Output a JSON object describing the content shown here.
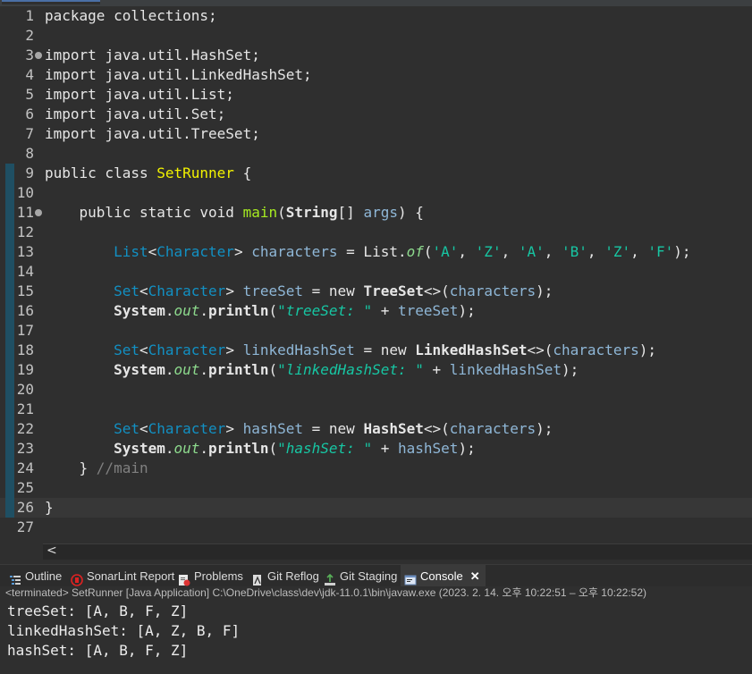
{
  "editor": {
    "lines": [
      {
        "n": "1",
        "tokens": [
          [
            "kw",
            "package "
          ],
          [
            "type",
            "collections"
          ],
          [
            "kw",
            ";"
          ]
        ]
      },
      {
        "n": "2",
        "tokens": []
      },
      {
        "n": "3",
        "fold": true,
        "tokens": [
          [
            "kw",
            "import "
          ],
          [
            "type",
            "java.util.HashSet;"
          ]
        ]
      },
      {
        "n": "4",
        "tokens": [
          [
            "kw",
            "import "
          ],
          [
            "type",
            "java.util.LinkedHashSet;"
          ]
        ]
      },
      {
        "n": "5",
        "tokens": [
          [
            "kw",
            "import "
          ],
          [
            "type",
            "java.util.List;"
          ]
        ]
      },
      {
        "n": "6",
        "tokens": [
          [
            "kw",
            "import "
          ],
          [
            "type",
            "java.util.Set;"
          ]
        ]
      },
      {
        "n": "7",
        "tokens": [
          [
            "kw",
            "import "
          ],
          [
            "type",
            "java.util.TreeSet;"
          ]
        ]
      },
      {
        "n": "8",
        "tokens": []
      },
      {
        "n": "9",
        "rail": true,
        "tokens": [
          [
            "kw",
            "public class "
          ],
          [
            "loc",
            "SetRunner"
          ],
          [
            "kw",
            " {"
          ]
        ]
      },
      {
        "n": "10",
        "rail": true,
        "tokens": []
      },
      {
        "n": "11",
        "rail": true,
        "fold": true,
        "tokens": [
          [
            "kw",
            "    public static void "
          ],
          [
            "meth",
            "main"
          ],
          [
            "kw",
            "("
          ],
          [
            "tbold",
            "String"
          ],
          [
            "kw",
            "[] "
          ],
          [
            "var",
            "args"
          ],
          [
            "kw",
            ") {"
          ]
        ]
      },
      {
        "n": "12",
        "rail": true,
        "tokens": []
      },
      {
        "n": "13",
        "rail": true,
        "tokens": [
          [
            "kw",
            "        "
          ],
          [
            "cls",
            "List"
          ],
          [
            "kw",
            "<"
          ],
          [
            "cls",
            "Character"
          ],
          [
            "kw",
            "> "
          ],
          [
            "var",
            "characters"
          ],
          [
            "kw",
            " = List."
          ],
          [
            "fld",
            "of"
          ],
          [
            "kw",
            "("
          ],
          [
            "chr",
            "'A'"
          ],
          [
            "kw",
            ", "
          ],
          [
            "chr",
            "'Z'"
          ],
          [
            "kw",
            ", "
          ],
          [
            "chr",
            "'A'"
          ],
          [
            "kw",
            ", "
          ],
          [
            "chr",
            "'B'"
          ],
          [
            "kw",
            ", "
          ],
          [
            "chr",
            "'Z'"
          ],
          [
            "kw",
            ", "
          ],
          [
            "chr",
            "'F'"
          ],
          [
            "kw",
            ");"
          ]
        ]
      },
      {
        "n": "14",
        "rail": true,
        "tokens": []
      },
      {
        "n": "15",
        "rail": true,
        "tokens": [
          [
            "kw",
            "        "
          ],
          [
            "cls",
            "Set"
          ],
          [
            "kw",
            "<"
          ],
          [
            "cls",
            "Character"
          ],
          [
            "kw",
            "> "
          ],
          [
            "var",
            "treeSet"
          ],
          [
            "kw",
            " = new "
          ],
          [
            "tbold",
            "TreeSet"
          ],
          [
            "kw",
            "<>("
          ],
          [
            "var",
            "characters"
          ],
          [
            "kw",
            ");"
          ]
        ]
      },
      {
        "n": "16",
        "rail": true,
        "tokens": [
          [
            "kw",
            "        "
          ],
          [
            "sys",
            "System"
          ],
          [
            "kw",
            "."
          ],
          [
            "fld",
            "out"
          ],
          [
            "kw",
            "."
          ],
          [
            "sysc",
            "println"
          ],
          [
            "kw",
            "("
          ],
          [
            "str",
            "\"treeSet: \""
          ],
          [
            "kw",
            " + "
          ],
          [
            "var",
            "treeSet"
          ],
          [
            "kw",
            ");"
          ]
        ]
      },
      {
        "n": "17",
        "rail": true,
        "tokens": []
      },
      {
        "n": "18",
        "rail": true,
        "tokens": [
          [
            "kw",
            "        "
          ],
          [
            "cls",
            "Set"
          ],
          [
            "kw",
            "<"
          ],
          [
            "cls",
            "Character"
          ],
          [
            "kw",
            "> "
          ],
          [
            "var",
            "linkedHashSet"
          ],
          [
            "kw",
            " = new "
          ],
          [
            "tbold",
            "LinkedHashSet"
          ],
          [
            "kw",
            "<>("
          ],
          [
            "var",
            "characters"
          ],
          [
            "kw",
            ");"
          ]
        ]
      },
      {
        "n": "19",
        "rail": true,
        "tokens": [
          [
            "kw",
            "        "
          ],
          [
            "sys",
            "System"
          ],
          [
            "kw",
            "."
          ],
          [
            "fld",
            "out"
          ],
          [
            "kw",
            "."
          ],
          [
            "sysc",
            "println"
          ],
          [
            "kw",
            "("
          ],
          [
            "str",
            "\"linkedHashSet: \""
          ],
          [
            "kw",
            " + "
          ],
          [
            "var",
            "linkedHashSet"
          ],
          [
            "kw",
            ");"
          ]
        ]
      },
      {
        "n": "20",
        "rail": true,
        "tokens": []
      },
      {
        "n": "21",
        "rail": true,
        "tokens": []
      },
      {
        "n": "22",
        "rail": true,
        "tokens": [
          [
            "kw",
            "        "
          ],
          [
            "cls",
            "Set"
          ],
          [
            "kw",
            "<"
          ],
          [
            "cls",
            "Character"
          ],
          [
            "kw",
            "> "
          ],
          [
            "var",
            "hashSet"
          ],
          [
            "kw",
            " = new "
          ],
          [
            "tbold",
            "HashSet"
          ],
          [
            "kw",
            "<>("
          ],
          [
            "var",
            "characters"
          ],
          [
            "kw",
            ");"
          ]
        ]
      },
      {
        "n": "23",
        "rail": true,
        "tokens": [
          [
            "kw",
            "        "
          ],
          [
            "sys",
            "System"
          ],
          [
            "kw",
            "."
          ],
          [
            "fld",
            "out"
          ],
          [
            "kw",
            "."
          ],
          [
            "sysc",
            "println"
          ],
          [
            "kw",
            "("
          ],
          [
            "str",
            "\"hashSet: \""
          ],
          [
            "kw",
            " + "
          ],
          [
            "var",
            "hashSet"
          ],
          [
            "kw",
            ");"
          ]
        ]
      },
      {
        "n": "24",
        "rail": true,
        "tokens": [
          [
            "kw",
            "    } "
          ],
          [
            "cmt",
            "//main"
          ]
        ]
      },
      {
        "n": "25",
        "rail": true,
        "tokens": []
      },
      {
        "n": "26",
        "rail": true,
        "hl": true,
        "tokens": [
          [
            "kw",
            "}"
          ]
        ]
      },
      {
        "n": "27",
        "tokens": []
      }
    ]
  },
  "hscroll": {
    "left_arrow": "<"
  },
  "tabs": [
    {
      "name": "outline",
      "label": "Outline",
      "icon": "outline-icon"
    },
    {
      "name": "sonarlint",
      "label": "SonarLint Report",
      "icon": "sonarlint-icon"
    },
    {
      "name": "problems",
      "label": "Problems",
      "icon": "problems-icon"
    },
    {
      "name": "git-reflog",
      "label": "Git Reflog",
      "icon": "git-reflog-icon"
    },
    {
      "name": "git-staging",
      "label": "Git Staging",
      "icon": "git-staging-icon"
    },
    {
      "name": "console",
      "label": "Console",
      "icon": "console-icon",
      "active": true,
      "close": "✕"
    }
  ],
  "console": {
    "status": "<terminated> SetRunner [Java Application] C:\\OneDrive\\class\\dev\\jdk-11.0.1\\bin\\javaw.exe  (2023. 2. 14. 오후 10:22:51 – 오후 10:22:52)",
    "output": [
      "treeSet: [A, B, F, Z]",
      "linkedHashSet: [A, Z, B, F]",
      "hashSet: [A, B, F, Z]"
    ]
  }
}
